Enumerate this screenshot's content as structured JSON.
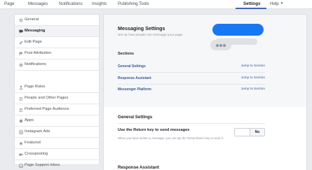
{
  "topnav": {
    "items": [
      "Page",
      "Messages",
      "Notifications",
      "Insights",
      "Publishing Tools"
    ],
    "settings": "Settings",
    "help": "Help"
  },
  "sidebar": {
    "items": [
      {
        "label": "General",
        "icon": "gear-icon"
      },
      {
        "label": "Messaging",
        "icon": "messaging-icon"
      },
      {
        "label": "Edit Page",
        "icon": "pencil-icon"
      },
      {
        "label": "Post Attribution",
        "icon": "flag-icon"
      },
      {
        "label": "Notifications",
        "icon": "globe-icon"
      },
      {
        "label": "Page Roles",
        "icon": "person-icon"
      },
      {
        "label": "People and Other Pages",
        "icon": "people-icon"
      },
      {
        "label": "Preferred Page Audience",
        "icon": "people-icon"
      },
      {
        "label": "Apps",
        "icon": "apps-icon"
      },
      {
        "label": "Instagram Ads",
        "icon": "instagram-icon"
      },
      {
        "label": "Featured",
        "icon": "star-icon"
      },
      {
        "label": "Crossposting",
        "icon": "video-icon"
      },
      {
        "label": "Page Support Inbox",
        "icon": "inbox-icon"
      }
    ]
  },
  "main": {
    "title": "Messaging Settings",
    "subtitle": "Set up how people can message your page",
    "sections_label": "Sections",
    "sections": [
      {
        "name": "General Settings",
        "jump": "Jump to Section"
      },
      {
        "name": "Response Assistant",
        "jump": "Jump to Section"
      },
      {
        "name": "Messenger Platform",
        "jump": "Jump to Section"
      }
    ],
    "general_settings": {
      "title": "General Settings",
      "return_key_label": "Use the Return key to send messages",
      "return_key_desc": "When you have written a message, you can tap the Return/Enter key to send it.",
      "toggle_value": "No"
    },
    "response_assistant_title": "Response Assistant"
  },
  "colors": {
    "accent": "#4267b2",
    "bubble": "#1877f2",
    "link": "#365899"
  }
}
